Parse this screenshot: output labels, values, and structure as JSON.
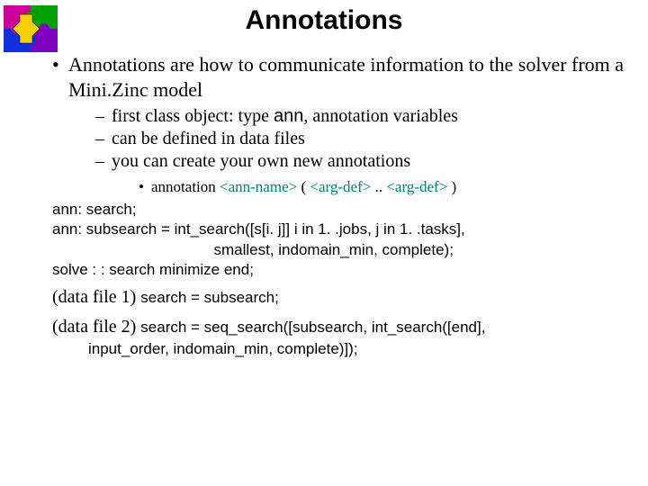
{
  "title": "Annotations",
  "bullet1_a": "Annotations are how to communicate information to the solver from a Mini.",
  "bullet1_b": "Zinc model",
  "sub1_a": "first class object: type ",
  "sub1_ann": "ann",
  "sub1_b": ", annotation variables",
  "sub2": "can be defined in data files",
  "sub3": "you can create your own new annotations",
  "syntax_a": "annotation ",
  "syntax_b": "<ann-name>",
  "syntax_c": " ( ",
  "syntax_d": "<arg-def>",
  "syntax_e": " .. ",
  "syntax_f": "<arg-def>",
  "syntax_g": " )",
  "code1": "ann: search;",
  "code2": "ann: subsearch = int_search([s[i. j]] i in 1. .jobs, j in 1. .tasks],",
  "code3": "                                      smallest, indomain_min, complete);",
  "code4": "solve : : search minimize end;",
  "df1_lead": "(data file 1) ",
  "df1_tail": "search = subsearch;",
  "df2_lead": "(data file 2) ",
  "df2_tail": "search = seq_search([subsearch, int_search([end],",
  "df2_cont": "input_order, indomain_min, complete)]);"
}
